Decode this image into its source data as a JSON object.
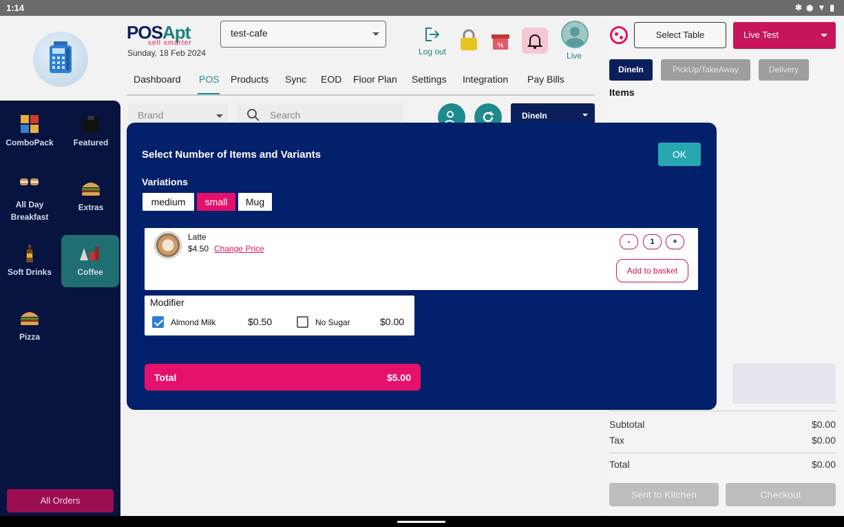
{
  "status_bar": {
    "time": "1:14",
    "icons": [
      "bluetooth-icon",
      "vibrate-icon",
      "wifi-icon",
      "battery-icon"
    ]
  },
  "header": {
    "brand_pos": "POS",
    "brand_apt": "Apt",
    "tagline": "sell smarter",
    "date": "Sunday, 18 Feb 2024",
    "store": "test-cafe",
    "logout_label": "Log out",
    "live_label": "Live"
  },
  "nav": {
    "items": [
      "Dashboard",
      "POS",
      "Products",
      "Sync",
      "EOD",
      "Floor Plan",
      "Settings",
      "Integration",
      "Pay Bills"
    ],
    "active": "POS"
  },
  "filters": {
    "brand_placeholder": "Brand",
    "search_placeholder": "Search",
    "order_type": "DineIn"
  },
  "categories": [
    {
      "label": "ComboPack",
      "icon": "combo-icon"
    },
    {
      "label": "Featured",
      "icon": "featured-icon"
    },
    {
      "label": "All Day Breakfast",
      "icon": "breakfast-icon"
    },
    {
      "label": "Extras",
      "icon": "burger-icon"
    },
    {
      "label": "Soft Drinks",
      "icon": "bottle-icon"
    },
    {
      "label": "Coffee",
      "icon": "coffee-icon",
      "active": true
    },
    {
      "label": "Pizza",
      "icon": "pizza-icon"
    }
  ],
  "all_orders_label": "All Orders",
  "order_panel": {
    "select_table": "Select Table",
    "live_test": "Live Test",
    "tabs": [
      "DineIn",
      "PickUp/TakeAway",
      "Delivery"
    ],
    "active_tab": "DineIn",
    "items_label": "Items",
    "subtotal_label": "Subtotal",
    "subtotal_value": "$0.00",
    "tax_label": "Tax",
    "tax_value": "$0.00",
    "total_label": "Total",
    "total_value": "$0.00",
    "sent_to_kitchen": "Sent to Kitchen",
    "checkout": "Checkout"
  },
  "modal": {
    "title": "Select Number of Items and Variants",
    "ok_label": "OK",
    "variations_label": "Variations",
    "variations": [
      "medium",
      "small",
      "Mug"
    ],
    "selected_variation": "small",
    "product": {
      "name": "Latte",
      "price": "$4.50",
      "change_price_label": "Change Price",
      "minus": "-",
      "quantity": "1",
      "plus": "+",
      "add_to_basket": "Add to basket"
    },
    "modifier": {
      "title": "Modifier",
      "options": [
        {
          "label": "Almond Milk",
          "price": "$0.50",
          "checked": true
        },
        {
          "label": "No Sugar",
          "price": "$0.00",
          "checked": false
        }
      ]
    },
    "total_label": "Total",
    "total_value": "$5.00"
  },
  "colors": {
    "navy": "#03206b",
    "pink": "#e5106b",
    "teal": "#1f8a8e",
    "sidebar": "#06143f"
  }
}
